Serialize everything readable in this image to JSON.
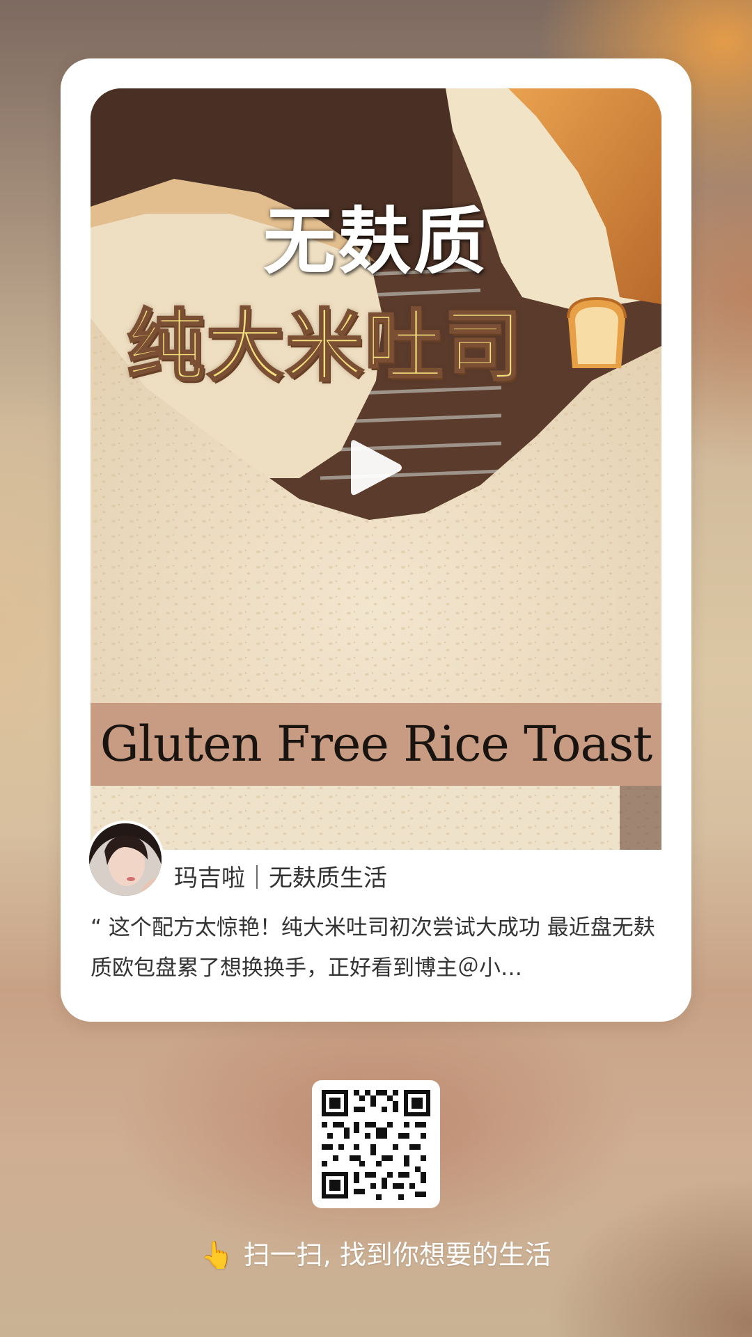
{
  "post": {
    "headline_top": "无麸质",
    "headline_main": "纯大米吐司",
    "banner_text": "Gluten Free Rice Toast",
    "author": "玛吉啦｜无麸质生活",
    "excerpt": "“ 这个配方太惊艳！纯大米吐司初次尝试大成功 最近盘无麸质欧包盘累了想换换手，正好看到博主＠小…"
  },
  "footer": {
    "scan_icon": "👆",
    "scan_text": "扫一扫, 找到你想要的生活"
  },
  "icons": {
    "play": "play-icon",
    "toast": "bread-emoji-icon",
    "qr": "qr-code"
  },
  "colors": {
    "card_bg": "#ffffff",
    "banner_bg": "#c89b83",
    "headline_yellow": "#f4e07d"
  }
}
